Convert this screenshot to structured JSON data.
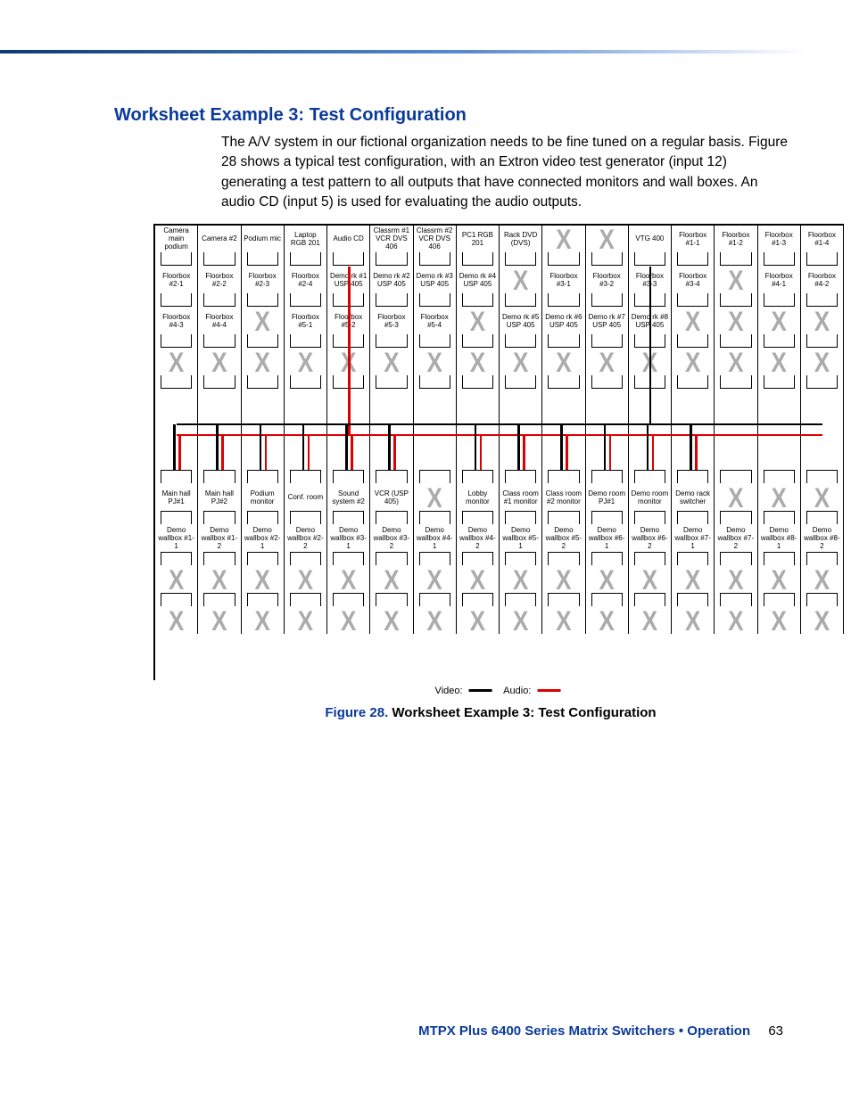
{
  "section_title": "Worksheet Example 3: Test Configuration",
  "paragraph": "The A/V system in our fictional organization needs to be fine tuned on a regular basis. Figure 28 shows a typical test configuration, with an Extron video test generator (input 12) generating a test pattern to all outputs that have connected monitors and wall boxes. An audio CD (input 5) is used for evaluating the audio outputs.",
  "figure_caption_label": "Figure 28.",
  "figure_caption_text": "Worksheet Example 3: Test Configuration",
  "legend_video": "Video:",
  "legend_audio": "Audio:",
  "footer_doc": "MTPX Plus 6400 Series Matrix Switchers • Operation",
  "footer_page": "63",
  "inputs": {
    "row1": [
      "Camera main podium",
      "Camera #2",
      "Podium mic",
      "Laptop RGB 201",
      "Audio CD",
      "Classrm #1 VCR DVS 406",
      "Classrm #2 VCR DVS 406",
      "PC1 RGB 201",
      "Rack DVD (DVS)",
      "X",
      "X",
      "VTG 400",
      "Floorbox #1-1",
      "Floorbox #1-2",
      "Floorbox #1-3",
      "Floorbox #1-4"
    ],
    "row2": [
      "Floorbox #2-1",
      "Floorbox #2-2",
      "Floorbox #2-3",
      "Floorbox #2-4",
      "Demo rk #1 USP 405",
      "Demo rk #2 USP 405",
      "Demo rk #3 USP 405",
      "Demo rk #4 USP 405",
      "X",
      "Floorbox #3-1",
      "Floorbox #3-2",
      "Floorbox #3-3",
      "Floorbox #3-4",
      "X",
      "Floorbox #4-1",
      "Floorbox #4-2"
    ],
    "row3": [
      "Floorbox #4-3",
      "Floorbox #4-4",
      "X",
      "Floorbox #5-1",
      "Floorbox #5-2",
      "Floorbox #5-3",
      "Floorbox #5-4",
      "X",
      "Demo rk #5 USP 405",
      "Demo rk #6 USP 405",
      "Demo rk #7 USP 405",
      "Demo rk #8 USP 405",
      "X",
      "X",
      "X",
      "X"
    ],
    "row4": [
      "X",
      "X",
      "X",
      "X",
      "X",
      "X",
      "X",
      "X",
      "X",
      "X",
      "X",
      "X",
      "X",
      "X",
      "X",
      "X"
    ]
  },
  "outputs": {
    "row1": [
      "Main hall PJ#1",
      "Main hall PJ#2",
      "Podium monitor",
      "Conf. room",
      "Sound system #2",
      "VCR (USP 405)",
      "X",
      "Lobby monitor",
      "Class room #1 monitor",
      "Class room #2 monitor",
      "Demo room PJ#1",
      "Demo room monitor",
      "Demo rack switcher",
      "X",
      "X",
      "X"
    ],
    "row2": [
      "Demo wallbox #1-1",
      "Demo wallbox #1-2",
      "Demo wallbox #2-1",
      "Demo wallbox #2-2",
      "Demo wallbox #3-1",
      "Demo wallbox #3-2",
      "Demo wallbox #4-1",
      "Demo wallbox #4-2",
      "Demo wallbox #5-1",
      "Demo wallbox #5-2",
      "Demo wallbox #6-1",
      "Demo wallbox #6-2",
      "Demo wallbox #7-1",
      "Demo wallbox #7-2",
      "Demo wallbox #8-1",
      "Demo wallbox #8-2"
    ],
    "row3": [
      "X",
      "X",
      "X",
      "X",
      "X",
      "X",
      "X",
      "X",
      "X",
      "X",
      "X",
      "X",
      "X",
      "X",
      "X",
      "X"
    ],
    "row4": [
      "X",
      "X",
      "X",
      "X",
      "X",
      "X",
      "X",
      "X",
      "X",
      "X",
      "X",
      "X",
      "X",
      "X",
      "X",
      "X"
    ]
  }
}
